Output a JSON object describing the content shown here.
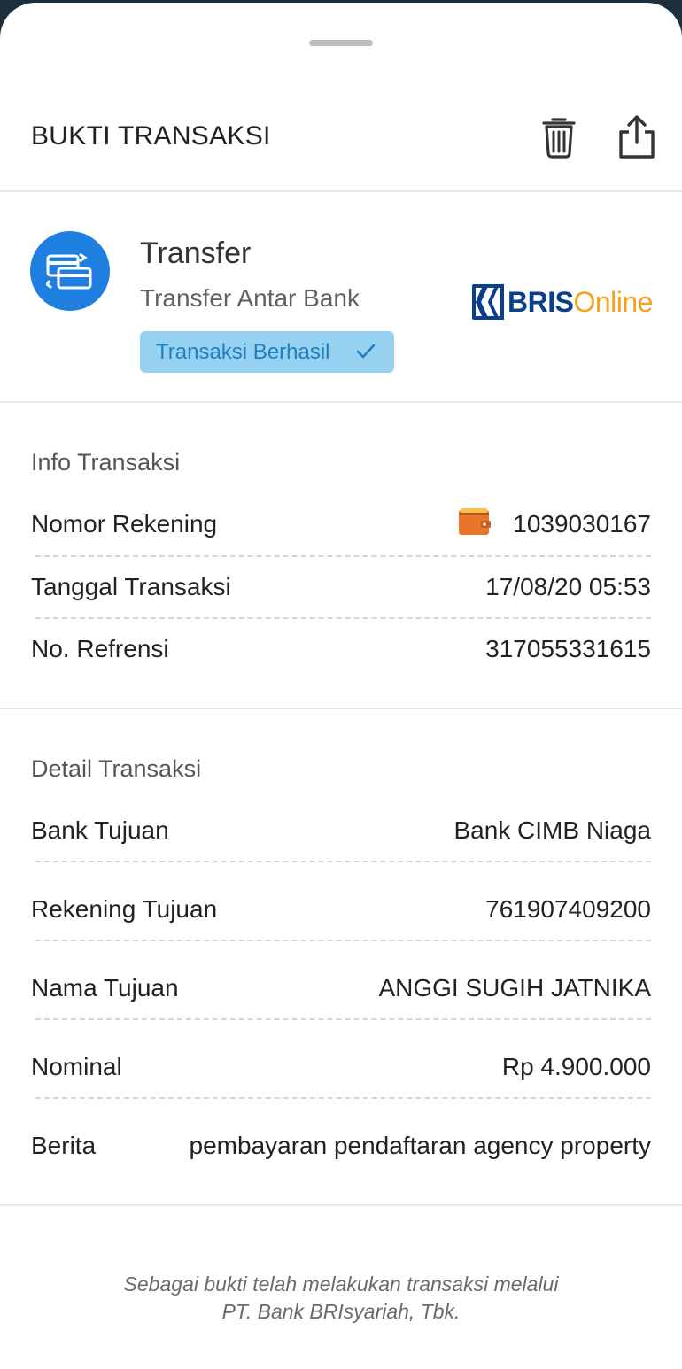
{
  "header": {
    "title": "BUKTI TRANSAKSI"
  },
  "transaction": {
    "type": "Transfer",
    "subtype": "Transfer Antar Bank",
    "status": "Transaksi Berhasil",
    "status_color": "#1f7fc0",
    "icon_color": "#1e7fe0"
  },
  "logo": {
    "part1": "BRIS",
    "part2": "Online",
    "brand_color": "#0a3f8c",
    "accent_color": "#f5a020"
  },
  "info": {
    "title": "Info Transaksi",
    "rows": [
      {
        "label": "Nomor Rekening",
        "value": "1039030167",
        "icon": "wallet-icon"
      },
      {
        "label": "Tanggal Transaksi",
        "value": "17/08/20 05:53"
      },
      {
        "label": "No. Refrensi",
        "value": "317055331615"
      }
    ]
  },
  "detail": {
    "title": "Detail Transaksi",
    "rows": [
      {
        "label": "Bank Tujuan",
        "value": "Bank CIMB Niaga"
      },
      {
        "label": "Rekening Tujuan",
        "value": "761907409200"
      },
      {
        "label": "Nama Tujuan",
        "value": "ANGGI SUGIH JATNIKA"
      },
      {
        "label": "Nominal",
        "value": "Rp 4.900.000"
      },
      {
        "label": "Berita",
        "value": "pembayaran pendaftaran agency property"
      }
    ]
  },
  "footer": {
    "line1": "Sebagai bukti telah melakukan transaksi melalui",
    "line2": "PT. Bank BRIsyariah, Tbk."
  }
}
